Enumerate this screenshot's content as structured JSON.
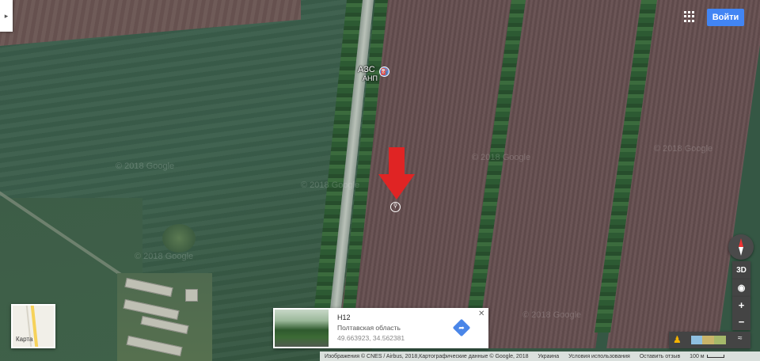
{
  "top_bar": {
    "apps_icon": "apps-grid-icon",
    "signin_label": "Войти",
    "signin_color": "#4285f4"
  },
  "side_panel": {
    "toggle_icon": "expand-panel-icon",
    "toggle_glyph": "▸"
  },
  "poi": {
    "line1": "АЗС",
    "line2": "АНП",
    "icon": "fuel-station-icon",
    "glyph": "⛽"
  },
  "watermarks": [
    "© 2018 Google",
    "© 2018 Google",
    "© 2018 Google",
    "© 2018 Google",
    "© 2018 Google",
    "© 2018 Google"
  ],
  "marker": {
    "arrow_color": "#e02424",
    "pin_icon": "place-pin-icon",
    "pin_glyph": "⚲"
  },
  "minimap": {
    "label": "Карта"
  },
  "info_card": {
    "title": "H12",
    "region": "Полтавская область",
    "coords": "49.663923, 34.562381",
    "close_glyph": "✕",
    "directions_icon": "directions-icon",
    "directions_glyph": "➦"
  },
  "controls": {
    "compass_icon": "compass-icon",
    "tilt_label": "3D",
    "location_icon": "my-location-icon",
    "location_glyph": "◉",
    "zoom_in": "+",
    "zoom_out": "−",
    "pegman_icon": "pegman-icon",
    "pegman_glyph": "♟",
    "expand_glyph": "≈"
  },
  "footer": {
    "imagery": "Изображения © CNES / Airbus, 2018,Картографические данные © Google, 2018",
    "country": "Украина",
    "terms": "Условия использования",
    "feedback": "Оставить отзыв",
    "scale": "100 м"
  }
}
